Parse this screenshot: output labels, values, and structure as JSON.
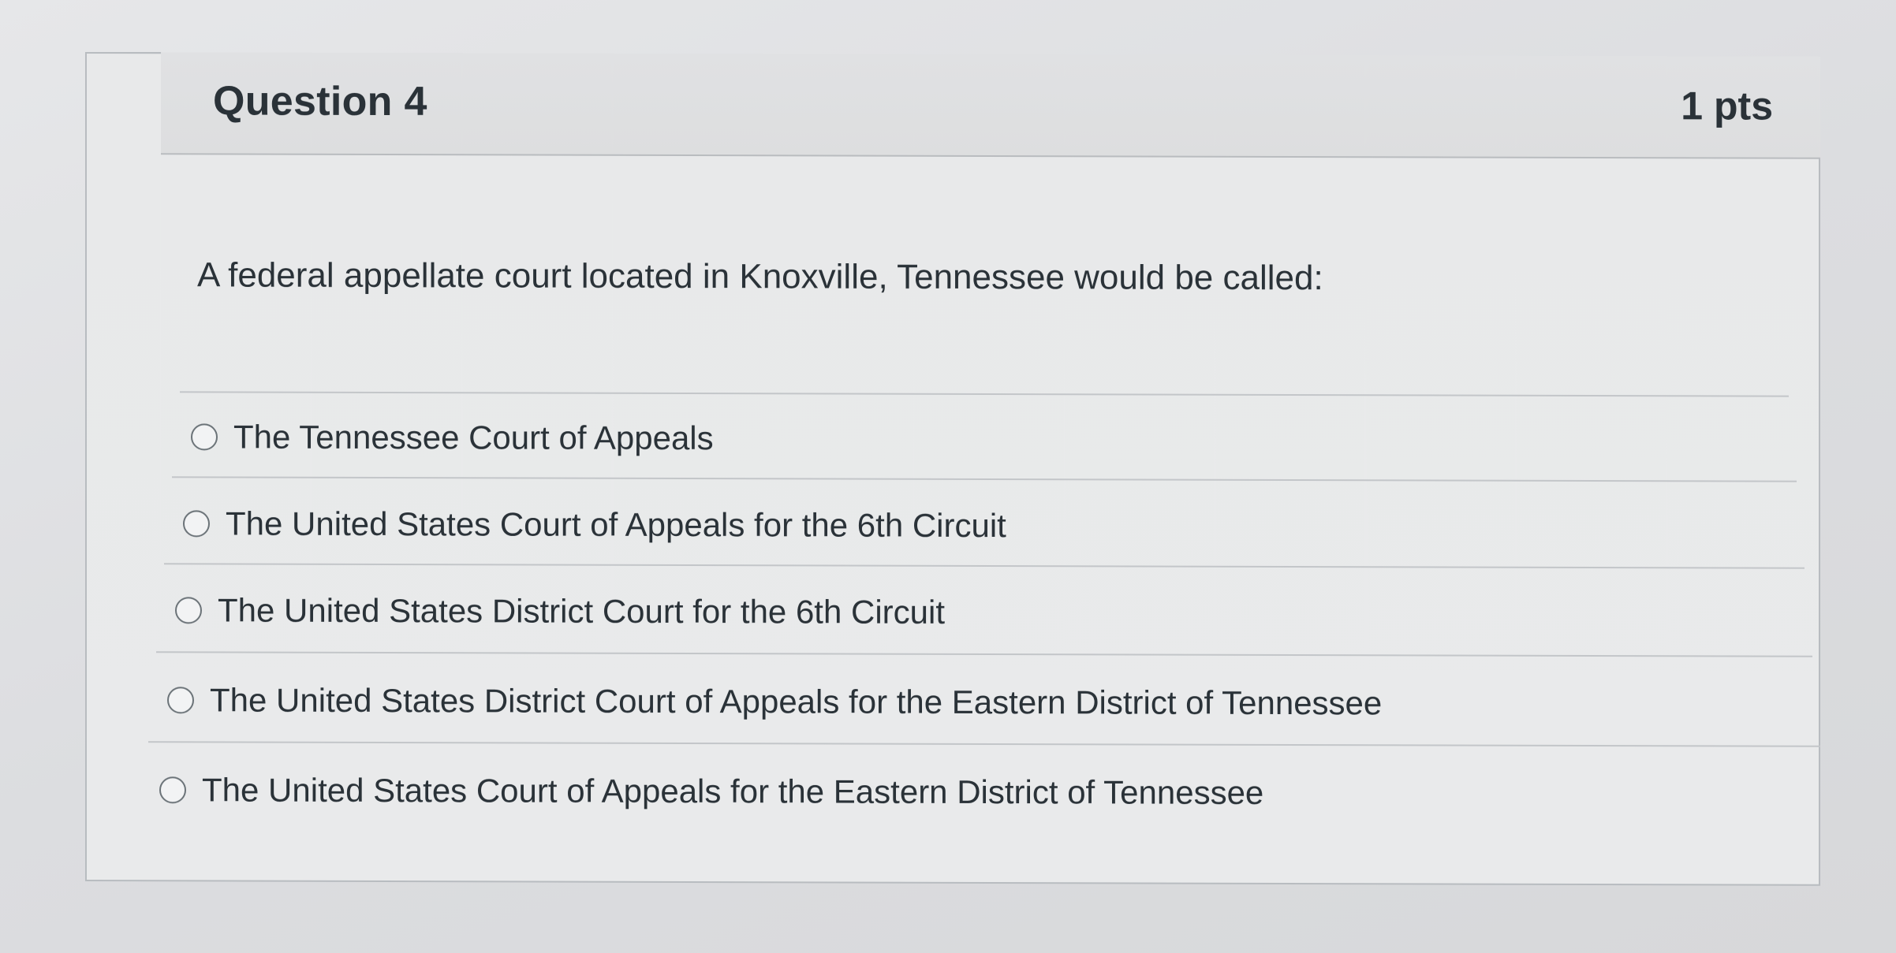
{
  "question": {
    "title": "Question 4",
    "points": "1 pts",
    "text": "A federal appellate court located in Knoxville, Tennessee would be called:",
    "answers": [
      {
        "label": "The Tennessee Court of Appeals"
      },
      {
        "label": "The United States Court of Appeals for the 6th Circuit"
      },
      {
        "label": "The United States District Court for the 6th Circuit"
      },
      {
        "label": "The United States District Court of Appeals for the Eastern District of Tennessee"
      },
      {
        "label": "The United States Court of Appeals for the Eastern District of Tennessee"
      }
    ]
  },
  "colors": {
    "background": "#dcdde0",
    "card": "#e9eaeb",
    "header": "#dddedf",
    "text": "#2a3238",
    "border": "#b8bcc0"
  }
}
